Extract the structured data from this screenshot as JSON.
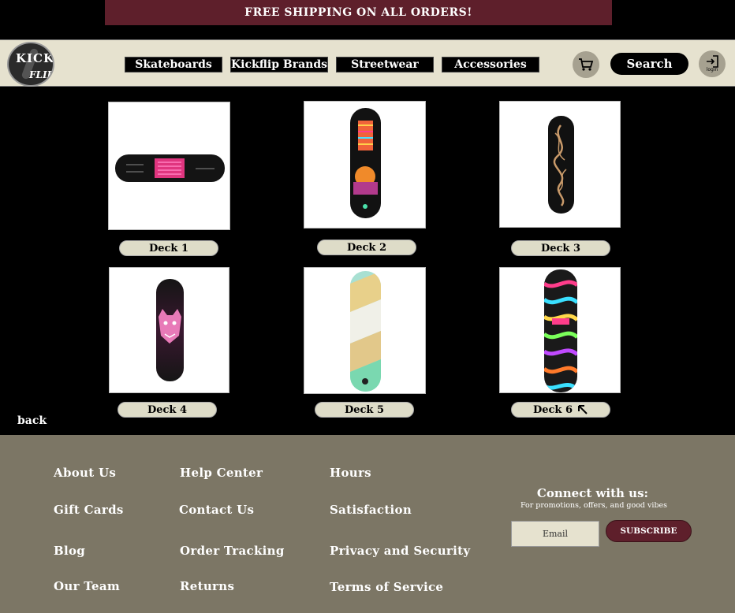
{
  "promo": {
    "text": "FREE SHIPPING ON ALL ORDERS!"
  },
  "logo": {
    "line1": "KICK",
    "line2": "FLIP"
  },
  "nav": {
    "items": [
      {
        "label": "Skateboards"
      },
      {
        "label": "Kickflip Brands"
      },
      {
        "label": "Streetwear"
      },
      {
        "label": "Accessories"
      }
    ],
    "search_label": "Search",
    "login_label": "login"
  },
  "products": [
    {
      "label": "Deck 1"
    },
    {
      "label": "Deck 2"
    },
    {
      "label": "Deck 3"
    },
    {
      "label": "Deck 4"
    },
    {
      "label": "Deck 5"
    },
    {
      "label": "Deck 6"
    }
  ],
  "back_label": "back",
  "footer": {
    "col1": [
      "About Us",
      "Gift Cards",
      "Blog",
      "Our Team"
    ],
    "col2": [
      "Help Center",
      "Contact Us",
      "Order Tracking",
      "Returns"
    ],
    "col3": [
      "Hours",
      "Satisfaction",
      "Privacy and Security",
      "Terms of Service"
    ],
    "connect_title": "Connect with us:",
    "connect_sub": "For promotions, offers, and good vibes",
    "email_placeholder": "Email",
    "subscribe_label": "SUBSCRIBE"
  },
  "colors": {
    "promo_bg": "#5e1f2b",
    "nav_bg": "#e6e2cf",
    "footer_bg": "#7c7665",
    "accent": "#5e1f2b"
  }
}
